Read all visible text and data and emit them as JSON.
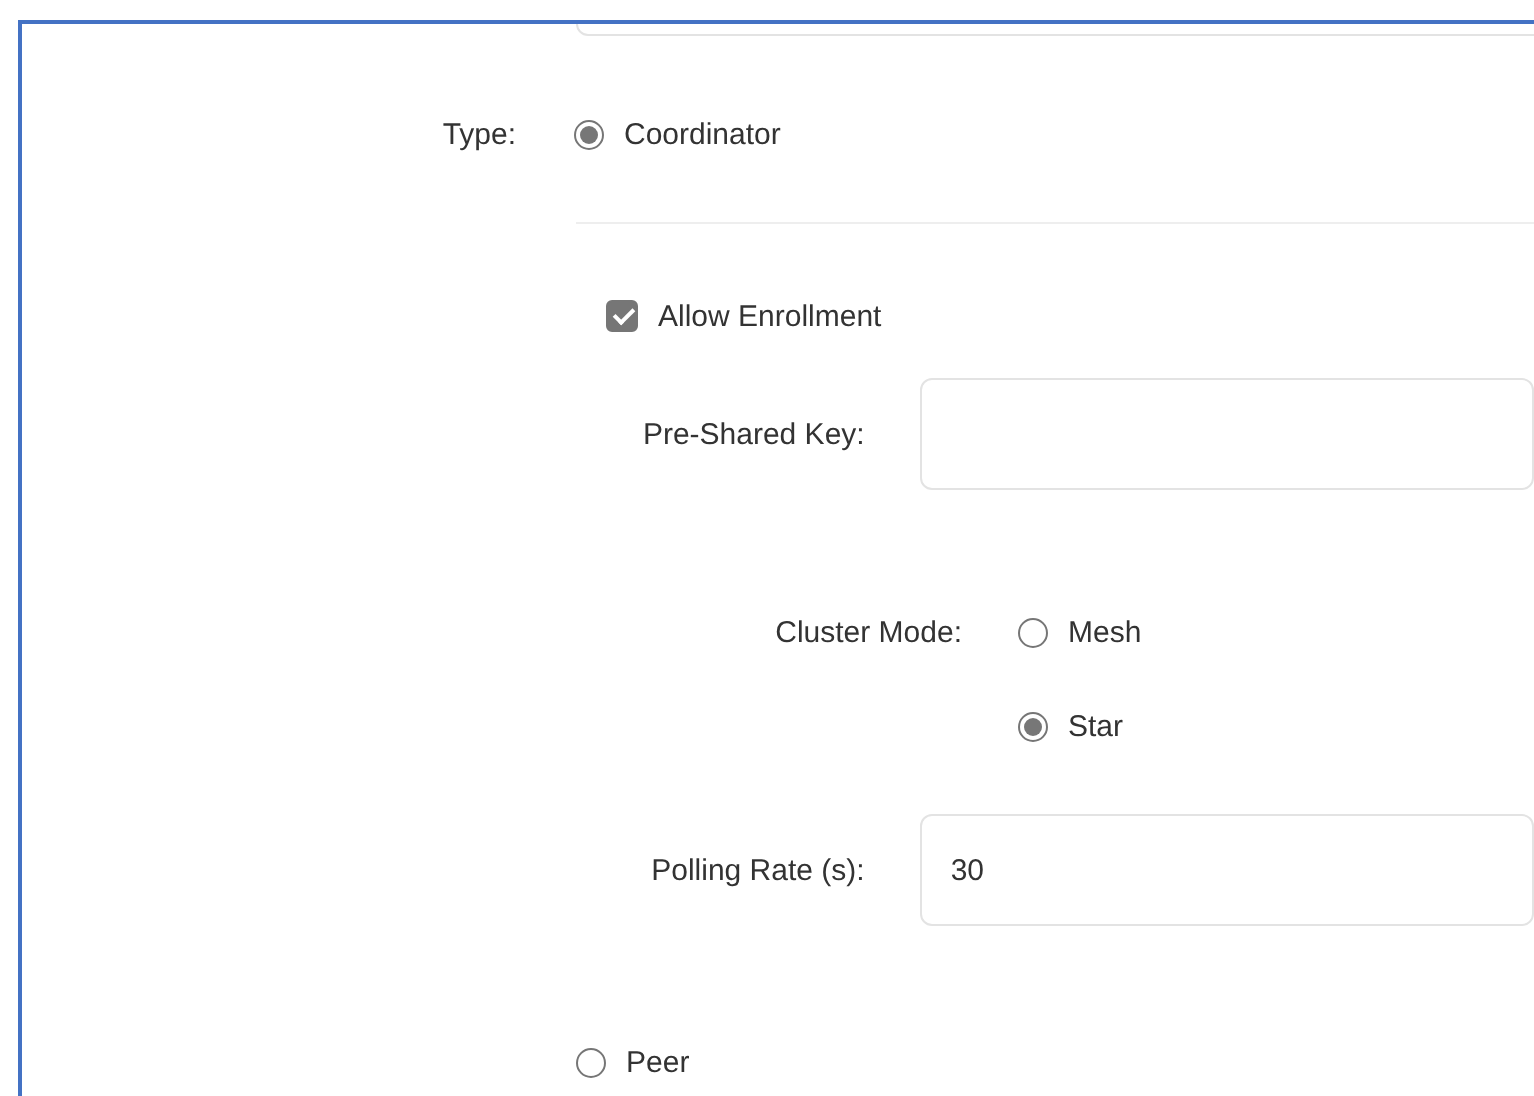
{
  "type_field": {
    "label": "Type:",
    "options": [
      {
        "label": "Coordinator",
        "selected": true
      },
      {
        "label": "Peer",
        "selected": false
      }
    ]
  },
  "coordinator_settings": {
    "allow_enrollment": {
      "label": "Allow Enrollment",
      "checked": true
    },
    "pre_shared_key": {
      "label": "Pre-Shared Key:"
    },
    "cluster_mode": {
      "label": "Cluster Mode:",
      "options": [
        {
          "label": "Mesh",
          "selected": false
        },
        {
          "label": "Star",
          "selected": true
        }
      ]
    },
    "polling_rate": {
      "label": "Polling Rate (s):",
      "value": "30"
    }
  }
}
